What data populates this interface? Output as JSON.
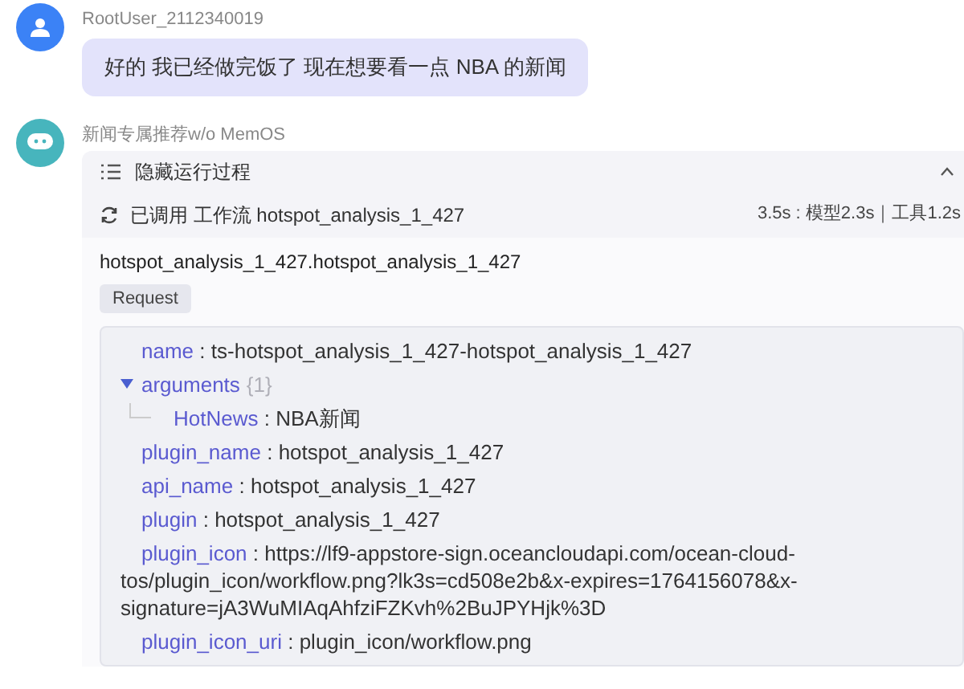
{
  "user_message": {
    "author": "RootUser_2112340019",
    "text": "好的 我已经做完饭了 现在想要看一点 NBA 的新闻"
  },
  "bot_message": {
    "author": "新闻专属推荐w/o MemOS",
    "process_panel": {
      "toggle_label": "隐藏运行过程",
      "expanded": true,
      "call_summary": "已调用 工作流 hotspot_analysis_1_427",
      "timing": "3.5s : 模型2.3s｜工具1.2s",
      "call_title": "hotspot_analysis_1_427.hotspot_analysis_1_427",
      "request_tab": "Request",
      "params": [
        {
          "kind": "field",
          "key": "name",
          "separator": ":",
          "value": "ts-hotspot_analysis_1_427-hotspot_analysis_1_427"
        },
        {
          "kind": "object",
          "key": "arguments",
          "count": "{1}",
          "expanded": true,
          "children": [
            {
              "kind": "field",
              "key": "HotNews",
              "separator": ":",
              "value": "NBA新闻"
            }
          ]
        },
        {
          "kind": "field",
          "key": "plugin_name",
          "separator": ":",
          "value": "hotspot_analysis_1_427"
        },
        {
          "kind": "field",
          "key": "api_name",
          "separator": ":",
          "value": "hotspot_analysis_1_427"
        },
        {
          "kind": "field",
          "key": "plugin",
          "separator": ":",
          "value": "hotspot_analysis_1_427"
        },
        {
          "kind": "field",
          "key": "plugin_icon",
          "separator": ":",
          "value": "https://lf9-appstore-sign.oceancloudapi.com/ocean-cloud-tos/plugin_icon/workflow.png?lk3s=cd508e2b&x-expires=1764156078&x-signature=jA3WuMIAqAhfziFZKvh%2BuJPYHjk%3D"
        },
        {
          "kind": "field",
          "key": "plugin_icon_uri",
          "separator": ":",
          "value": "plugin_icon/workflow.png"
        }
      ]
    }
  }
}
